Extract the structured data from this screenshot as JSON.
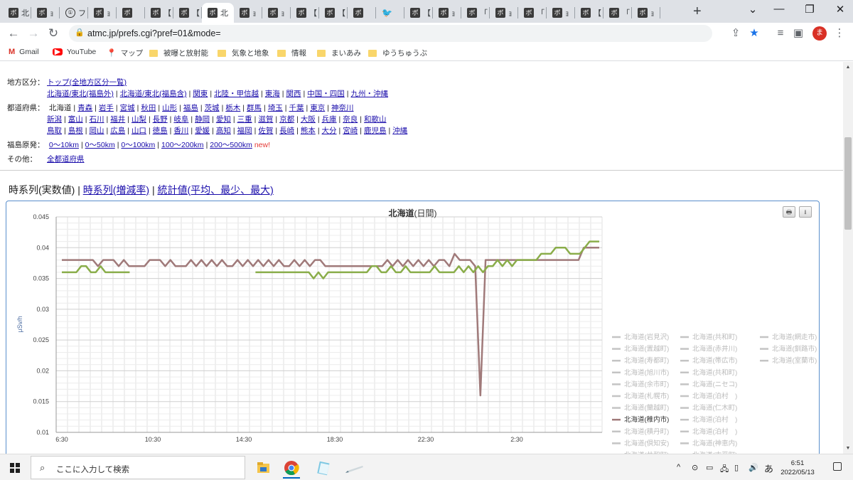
{
  "browser": {
    "tabs": [
      {
        "label": "北",
        "icon": "ボ"
      },
      {
        "label": "ｮ",
        "icon": "ボ"
      },
      {
        "label": "フ",
        "icon": "①",
        "circle": true
      },
      {
        "label": "ｮ",
        "icon": "ボ"
      },
      {
        "label": "",
        "icon": "ボ"
      },
      {
        "label": "【",
        "icon": "ボ"
      },
      {
        "label": "【",
        "icon": "ボ"
      },
      {
        "label": "北",
        "icon": "ボ",
        "active": true
      },
      {
        "label": "ｮ",
        "icon": "ボ"
      },
      {
        "label": "ｮ",
        "icon": "ボ"
      },
      {
        "label": "【",
        "icon": "ボ"
      },
      {
        "label": "【",
        "icon": "ボ"
      },
      {
        "label": "",
        "icon": "ボ"
      },
      {
        "label": "",
        "icon": "🐦",
        "twitter": true
      },
      {
        "label": "【",
        "icon": "ボ"
      },
      {
        "label": "ｮ",
        "icon": "ボ"
      },
      {
        "label": "「",
        "icon": "ボ"
      },
      {
        "label": "ｮ",
        "icon": "ボ"
      },
      {
        "label": "「",
        "icon": "ボ"
      },
      {
        "label": "ｮ",
        "icon": "ボ"
      },
      {
        "label": "【",
        "icon": "ボ"
      },
      {
        "label": "「",
        "icon": "ボ"
      },
      {
        "label": "ｮ",
        "icon": "ボ"
      }
    ],
    "close_glyph": "✕",
    "newtab_glyph": "+",
    "window_controls": {
      "chevron": "⌄",
      "minimize": "—",
      "maximize": "❐",
      "close": "✕"
    },
    "url": "atmc.jp/prefs.cgi?pref=01&mode=",
    "avatar_letter": "ま",
    "bookmarks": [
      {
        "label": "Gmail",
        "kind": "gmail"
      },
      {
        "label": "YouTube",
        "kind": "youtube"
      },
      {
        "label": "マップ",
        "kind": "maps"
      },
      {
        "label": "被曝と放射能",
        "kind": "folder"
      },
      {
        "label": "気象と地象",
        "kind": "folder"
      },
      {
        "label": "情報",
        "kind": "folder"
      },
      {
        "label": "まいあみ",
        "kind": "folder"
      },
      {
        "label": "ゆうちゅうぶ",
        "kind": "folder"
      }
    ]
  },
  "page": {
    "region_label": "地方区分：",
    "region_top_link": "トップ(全地方区分一覧)",
    "regions": [
      "北海道/東北(福島外)",
      "北海道/東北(福島含)",
      "関東",
      "北陸・甲信越",
      "東海",
      "関西",
      "中国・四国",
      "九州・沖縄"
    ],
    "pref_label": "都道府県：",
    "pref_rows": [
      {
        "current": "北海道",
        "items": [
          "青森",
          "岩手",
          "宮城",
          "秋田",
          "山形",
          "福島",
          "茨城",
          "栃木",
          "群馬",
          "埼玉",
          "千葉",
          "東京",
          "神奈川"
        ]
      },
      {
        "current": "",
        "items": [
          "新潟",
          "富山",
          "石川",
          "福井",
          "山梨",
          "長野",
          "岐阜",
          "静岡",
          "愛知",
          "三重",
          "滋賀",
          "京都",
          "大阪",
          "兵庫",
          "奈良",
          "和歌山"
        ]
      },
      {
        "current": "",
        "items": [
          "鳥取",
          "島根",
          "岡山",
          "広島",
          "山口",
          "徳島",
          "香川",
          "愛媛",
          "高知",
          "福岡",
          "佐賀",
          "長崎",
          "熊本",
          "大分",
          "宮崎",
          "鹿児島",
          "沖縄"
        ]
      }
    ],
    "fukushima_label": "福島原発：",
    "fukushima_links": [
      "0〜10km",
      "0〜50km",
      "0〜100km",
      "100〜200km",
      "200〜500km"
    ],
    "new_label": "new!",
    "other_label": "その他：",
    "other_link": "全都道府県",
    "series_tabs": {
      "current": "時系列(実数値)",
      "link1": "時系列(増減率)",
      "link2": "統計値(平均、最少、最大)"
    },
    "chart_buttons": {
      "print": "🖶",
      "download": "⭳"
    }
  },
  "chart_data": {
    "type": "line",
    "title_bold": "北海道",
    "title_rest": "(日間)",
    "ylabel": "μSv/h",
    "ylim": [
      0.01,
      0.045
    ],
    "yticks": [
      "0.045",
      "0.04",
      "0.035",
      "0.03",
      "0.025",
      "0.02",
      "0.015",
      "0.01"
    ],
    "xticks": [
      "6:30",
      "10:30",
      "14:30",
      "18:30",
      "22:30",
      "2:30"
    ],
    "grid": true,
    "legend_position": "right",
    "colors": {
      "brown": "#a07a7a",
      "green": "#8aad4a",
      "grey": "#c4c4c4"
    },
    "legend": [
      [
        "北海道(岩見沢)",
        "北海道(共和町)",
        "北海道(網走市)"
      ],
      [
        "北海道(置越町)",
        "北海道(赤井川)",
        "北海道(釧路市)"
      ],
      [
        "北海道(寿都町)",
        "北海道(帯広市)",
        "北海道(室蘭市)"
      ],
      [
        "北海道(旭川市)",
        "北海道(共和町)"
      ],
      [
        "北海道(余市町)",
        "北海道(ニセコ)"
      ],
      [
        "北海道(札幌市)",
        "北海道(泊村　)"
      ],
      [
        "北海道(蘭越町)",
        "北海道(仁木町)"
      ],
      [
        "北海道(稚内市)",
        "北海道(泊村　)"
      ],
      [
        "北海道(積丹町)",
        "北海道(泊村　)"
      ],
      [
        "北海道(倶知安)",
        "北海道(神恵内)"
      ],
      [
        "北海道(共和町)",
        "北海道(古平町)"
      ],
      [
        "北海道(岩内町)",
        "北海道(倶知安)"
      ],
      [
        "北海道(泊村　)",
        "北海道(倶知安)"
      ],
      [
        "北海道(仁木町)",
        "北海道(函館市)"
      ]
    ],
    "active_legend": {
      "北海道(稚内市)": "brown",
      "北海道(岩内町)": "green"
    },
    "x_count": 102,
    "series": [
      {
        "name": "北海道(稚内市)",
        "color": "brown",
        "values": [
          0.038,
          0.038,
          0.038,
          0.038,
          0.038,
          0.038,
          0.038,
          0.037,
          0.038,
          0.038,
          0.038,
          0.037,
          0.038,
          0.037,
          0.037,
          0.037,
          0.037,
          0.038,
          0.038,
          0.038,
          0.037,
          0.038,
          0.037,
          0.037,
          0.037,
          0.038,
          0.037,
          0.038,
          0.037,
          0.038,
          0.037,
          0.038,
          0.037,
          0.037,
          0.038,
          0.037,
          0.038,
          0.037,
          0.038,
          0.037,
          0.038,
          0.037,
          0.038,
          0.037,
          0.037,
          0.038,
          0.037,
          0.038,
          0.037,
          0.038,
          0.038,
          0.037,
          0.037,
          0.037,
          0.037,
          0.037,
          0.037,
          0.037,
          0.037,
          0.037,
          0.037,
          0.037,
          0.037,
          0.038,
          0.037,
          0.038,
          0.037,
          0.038,
          0.037,
          0.038,
          0.037,
          0.038,
          0.037,
          0.038,
          0.038,
          0.037,
          0.039,
          0.038,
          0.038,
          0.038,
          0.037,
          0.016,
          0.038,
          0.038,
          0.038,
          0.038,
          0.038,
          0.038,
          0.038,
          0.038,
          0.038,
          0.038,
          0.038,
          0.038,
          0.038,
          0.038,
          0.038,
          0.038,
          0.038,
          0.038,
          0.038,
          0.04,
          0.04,
          0.04,
          0.04
        ]
      },
      {
        "name": "北海道(岩内町)",
        "color": "green",
        "values": [
          0.036,
          0.036,
          0.036,
          0.036,
          0.037,
          0.037,
          0.036,
          0.036,
          0.037,
          0.036,
          0.036,
          0.036,
          0.036,
          0.036,
          0.036,
          null,
          null,
          null,
          null,
          null,
          null,
          null,
          null,
          null,
          null,
          null,
          null,
          null,
          null,
          null,
          null,
          null,
          null,
          null,
          null,
          null,
          null,
          null,
          null,
          null,
          0.036,
          0.036,
          0.036,
          0.036,
          0.036,
          0.036,
          0.036,
          0.036,
          0.036,
          0.036,
          0.036,
          0.036,
          0.035,
          0.036,
          0.035,
          0.036,
          0.036,
          0.036,
          0.036,
          0.036,
          0.036,
          0.036,
          0.036,
          0.036,
          0.037,
          0.037,
          0.036,
          0.036,
          0.037,
          0.036,
          0.036,
          0.037,
          0.036,
          0.036,
          0.036,
          0.036,
          0.036,
          0.037,
          0.036,
          0.036,
          0.036,
          0.036,
          0.037,
          0.036,
          0.037,
          0.036,
          0.037,
          0.036,
          0.037,
          0.037,
          0.038,
          0.037,
          0.038,
          0.037,
          0.038,
          0.038,
          0.038,
          0.038,
          0.038,
          0.039,
          0.039,
          0.039,
          0.04,
          0.04,
          0.04,
          0.039,
          0.039,
          0.039,
          0.04,
          0.041,
          0.041,
          0.041
        ]
      }
    ]
  },
  "taskbar": {
    "search_placeholder": "ここに入力して検索",
    "ime": "あ",
    "time": "6:51",
    "date": "2022/05/13",
    "tray_chevron": "^"
  }
}
